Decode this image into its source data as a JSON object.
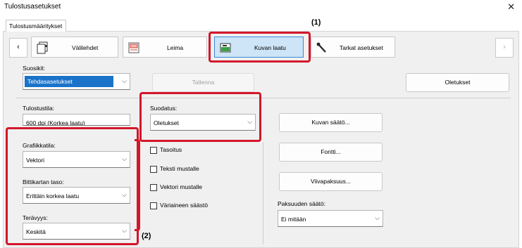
{
  "window": {
    "title": "Tulostusasetukset"
  },
  "tabs": [
    {
      "label": "Tulostusmääritykset"
    }
  ],
  "categories": [
    {
      "label": "Välilehdet",
      "icon": "tabs-pages-icon"
    },
    {
      "label": "Leima",
      "icon": "stamp-icon"
    },
    {
      "label": "Kuvan laatu",
      "icon": "image-quality-icon",
      "selected": true
    },
    {
      "label": "Tarkat asetukset",
      "icon": "wrench-icon"
    }
  ],
  "favorites": {
    "label": "Suosikit:",
    "value": "Tehdasasetukset",
    "save_button": "Tallenna",
    "defaults_button": "Oletukset"
  },
  "print_mode": {
    "label": "Tulostustila:",
    "value": "600 dpi (Korkea laatu)"
  },
  "filter": {
    "label": "Suodatus:",
    "value": "Oletukset"
  },
  "graphics_mode": {
    "label": "Grafiikkatila:",
    "value": "Vektori"
  },
  "bitmap_level": {
    "label": "Bittikartan taso:",
    "value": "Erittäin korkea laatu"
  },
  "sharpness": {
    "label": "Terävyys:",
    "value": "Keskitä"
  },
  "checkboxes": [
    {
      "label": "Tasoitus",
      "checked": false
    },
    {
      "label": "Teksti mustalle",
      "checked": false
    },
    {
      "label": "Vektori mustalle",
      "checked": false
    },
    {
      "label": "Väriaineen säästö",
      "checked": false
    }
  ],
  "right_buttons": {
    "image_adjust": "Kuvan säätö...",
    "font": "Fontti...",
    "line_width": "Viivapaksuus..."
  },
  "thickness": {
    "label": "Paksuuden säätö:",
    "value": "Ei mitään"
  },
  "callouts": {
    "one": "(1)",
    "two": "(2)"
  },
  "colors": {
    "highlight": "#d3172a",
    "selected_bg": "#cde5f7",
    "selection": "#1a73c9"
  }
}
